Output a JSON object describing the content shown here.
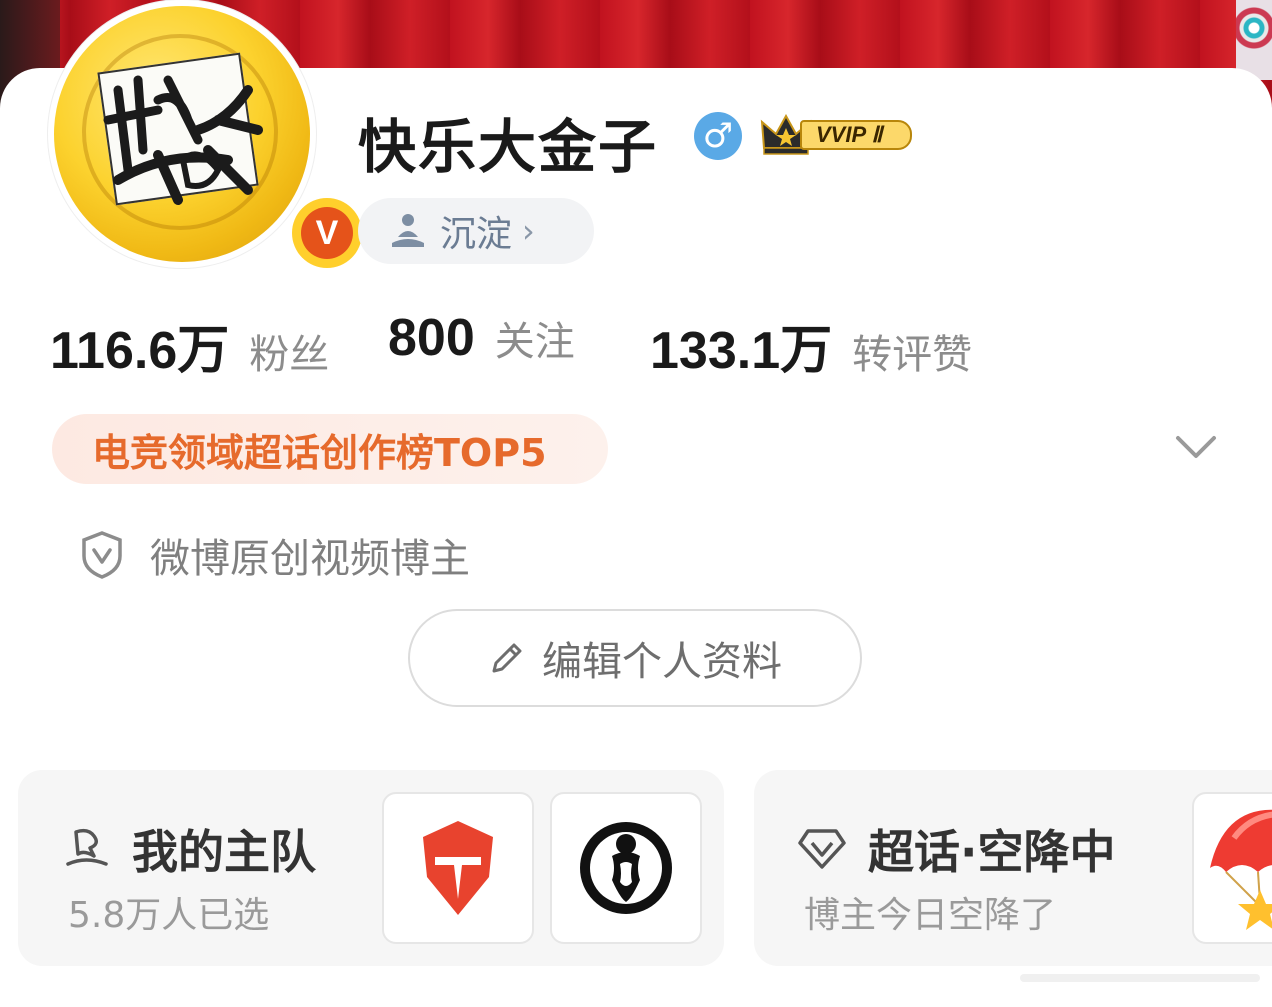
{
  "profile": {
    "name": "快乐大金子",
    "gender_symbol": "♂",
    "vip_label": "VVIP Ⅱ",
    "verified_mark": "V",
    "status": {
      "label": "沉淀",
      "chevron": "›"
    }
  },
  "stats": [
    {
      "value": "116.6万",
      "label": "粉丝"
    },
    {
      "value": "800",
      "label": "关注"
    },
    {
      "value": "133.1万",
      "label": "转评赞"
    }
  ],
  "rank_tag": "电竞领域超话创作榜TOP5",
  "certification": "微博原创视频博主",
  "edit_profile_label": "编辑个人资料",
  "team_card": {
    "title": "我的主队",
    "subtitle": "5.8万人已选",
    "logos": [
      "team-logo-red-icon",
      "team-logo-ig-icon"
    ]
  },
  "topic_card": {
    "title": "超话·空降中",
    "subtitle": "博主今日空降了",
    "icon": "parachute-icon"
  },
  "colors": {
    "accent_orange": "#e66a2c",
    "verified_orange": "#e5531a",
    "gender_blue": "#5aa9e6",
    "banner_red": "#c1121f"
  }
}
